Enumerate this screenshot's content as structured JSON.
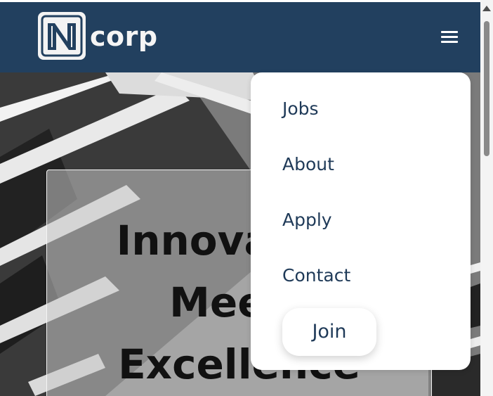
{
  "header": {
    "logo_text": "corp",
    "logo_icon": "n-logo-icon",
    "menu_icon": "hamburger-menu-icon"
  },
  "hero": {
    "title_lines": [
      "Innovation",
      "Meets",
      "Excellence"
    ]
  },
  "dropdown": {
    "items": [
      {
        "label": "Jobs"
      },
      {
        "label": "About"
      },
      {
        "label": "Apply"
      },
      {
        "label": "Contact"
      }
    ],
    "join_label": "Join"
  },
  "colors": {
    "header_bg": "#22405f",
    "menu_text": "#1f3a58"
  }
}
